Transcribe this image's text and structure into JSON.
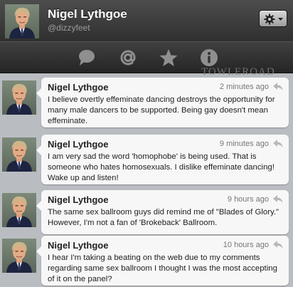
{
  "profile": {
    "name": "Nigel Lythgoe",
    "handle": "@dizzyfeet"
  },
  "header_icons": {
    "settings": "gear-icon",
    "menu": "chevron-down-icon"
  },
  "tabs": [
    {
      "name": "messages-tab",
      "icon": "speech-bubble-icon"
    },
    {
      "name": "mentions-tab",
      "icon": "at-sign-icon"
    },
    {
      "name": "favorites-tab",
      "icon": "star-icon"
    },
    {
      "name": "info-tab",
      "icon": "info-icon"
    }
  ],
  "watermark": "TOWLEROAD",
  "tweets": [
    {
      "author": "Nigel Lythgoe",
      "time": "2 minutes ago",
      "text": "I believe overtly effeminate dancing destroys the opportunity for many male dancers to be supported. Being gay doesn't mean effeminate."
    },
    {
      "author": "Nigel Lythgoe",
      "time": "9 minutes ago",
      "text": "I am very sad the word 'homophobe' is being used. That is someone who hates homosexuals. I dislike effeminate dancing! Wake up and listen!"
    },
    {
      "author": "Nigel Lythgoe",
      "time": "9 hours ago",
      "text": "The same sex ballroom guys did remind me of \"Blades of Glory.\" However, I'm not a fan of 'Brokeback' Ballroom."
    },
    {
      "author": "Nigel Lythgoe",
      "time": "10 hours ago",
      "text": "I hear I'm taking a beating on the web due to my comments regarding same sex ballroom I thought I was the most accepting of it on the panel?"
    }
  ],
  "colors": {
    "header_dark": "#2f2f2f",
    "bubble": "#f7f7f7",
    "timeline_bg": "#b9bdc1"
  }
}
